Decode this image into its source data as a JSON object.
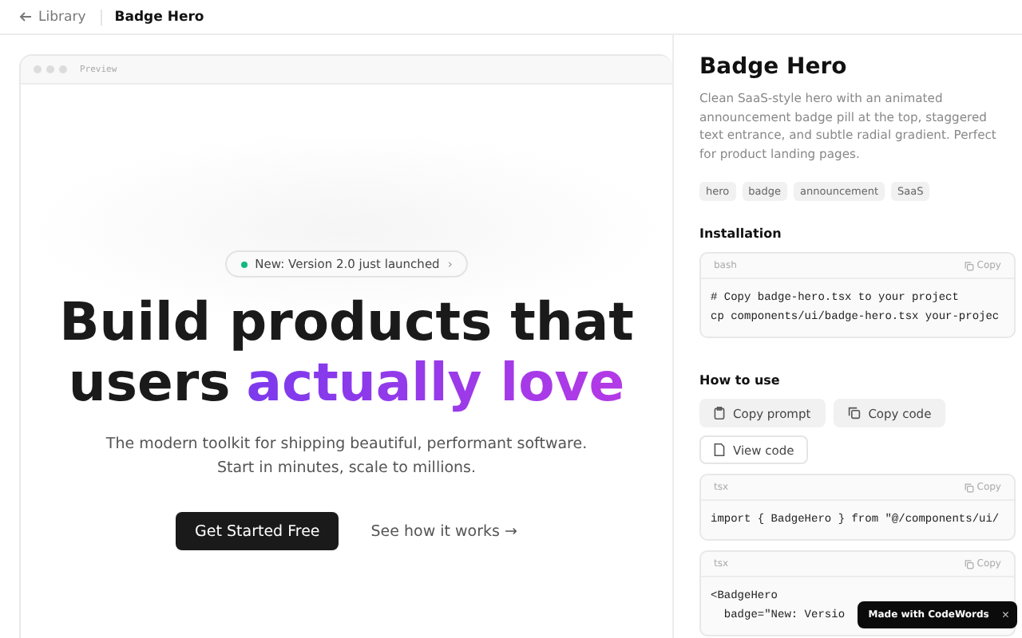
{
  "topbar": {
    "back": "Library",
    "title": "Badge Hero"
  },
  "preview": {
    "label": "Preview",
    "badge": "New: Version 2.0 just launched",
    "badge_arrow": "›",
    "headline": "Build products that",
    "headline_plain": "users",
    "headline_accent": "actually love",
    "subtitle": "The modern toolkit for shipping beautiful, performant software.",
    "subtitle2": "Start in minutes, scale to millions.",
    "primary": "Get Started Free",
    "secondary": "See how it works →"
  },
  "detail": {
    "title": "Badge Hero",
    "description": "Clean SaaS-style hero with an animated announcement badge pill at the top, staggered text entrance, and subtle radial gradient. Perfect for product landing pages.",
    "tags": [
      "hero",
      "badge",
      "announcement",
      "SaaS"
    ],
    "installation": "Installation",
    "install_block": {
      "lang": "bash",
      "copy": "Copy",
      "lines": [
        "# Copy badge-hero.tsx to your project",
        "cp components/ui/badge-hero.tsx your-projec"
      ]
    },
    "howto": "How to use",
    "actions": [
      {
        "kind": "prompt",
        "label": "Copy prompt"
      },
      {
        "kind": "copy",
        "label": "Copy code"
      },
      {
        "kind": "view",
        "label": "View code"
      }
    ],
    "code_blocks": [
      {
        "lang": "tsx",
        "copy": "Copy",
        "lines": [
          "import { BadgeHero } from \"@/components/ui/"
        ]
      },
      {
        "lang": "tsx",
        "copy": "Copy",
        "lines": [
          "<BadgeHero",
          "  badge=\"New: Versio"
        ]
      }
    ]
  },
  "toast": {
    "text": "Made with CodeWords",
    "close": "×"
  }
}
